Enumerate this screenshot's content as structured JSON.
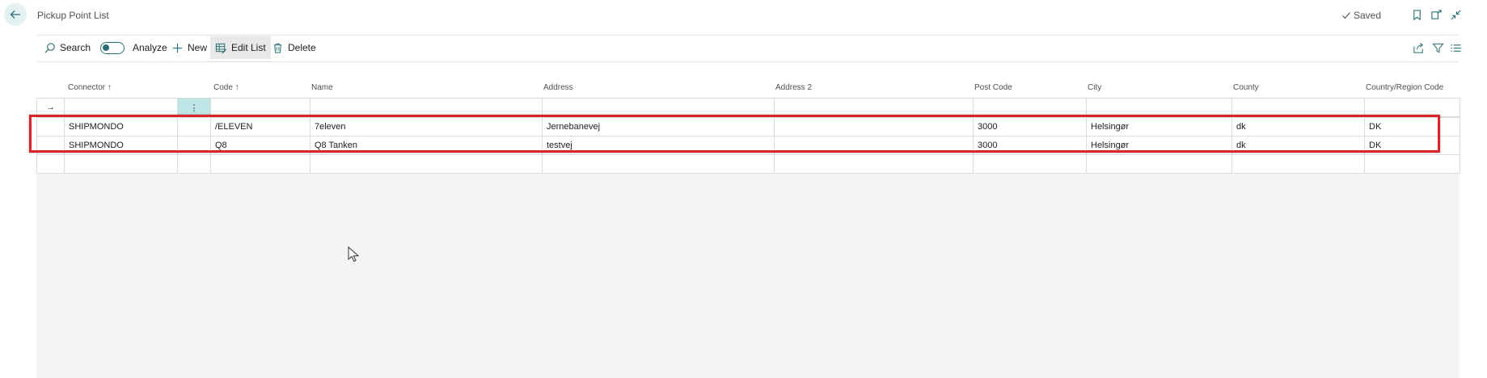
{
  "header": {
    "title": "Pickup Point List",
    "saved_label": "Saved"
  },
  "actions": {
    "search": "Search",
    "analyze": "Analyze",
    "new": "New",
    "edit_list": "Edit List",
    "delete": "Delete"
  },
  "columns": [
    "Connector ↑",
    "Code ↑",
    "Name",
    "Address",
    "Address 2",
    "Post Code",
    "City",
    "County",
    "Country/Region Code"
  ],
  "rows": [
    {
      "connector": "SHIPMONDO",
      "code": "/ELEVEN",
      "name": "7eleven",
      "address": "Jernebanevej",
      "address2": "",
      "post_code": "3000",
      "city": "Helsingør",
      "county": "dk",
      "country": "DK"
    },
    {
      "connector": "SHIPMONDO",
      "code": "Q8",
      "name": "Q8 Tanken",
      "address": "testvej",
      "address2": "",
      "post_code": "3000",
      "city": "Helsingør",
      "county": "dk",
      "country": "DK"
    }
  ],
  "icons": {
    "back": "arrow-left-icon",
    "saved": "checkmark-icon",
    "bookmark": "bookmark-icon",
    "open_new": "open-in-new-window-icon",
    "collapse": "collapse-icon",
    "share": "share-icon",
    "filter": "filter-icon",
    "list": "list-view-icon"
  },
  "colors": {
    "accent": "#2a6f75",
    "selected_cell": "#bfe6e7",
    "highlight": "#d9242b"
  }
}
